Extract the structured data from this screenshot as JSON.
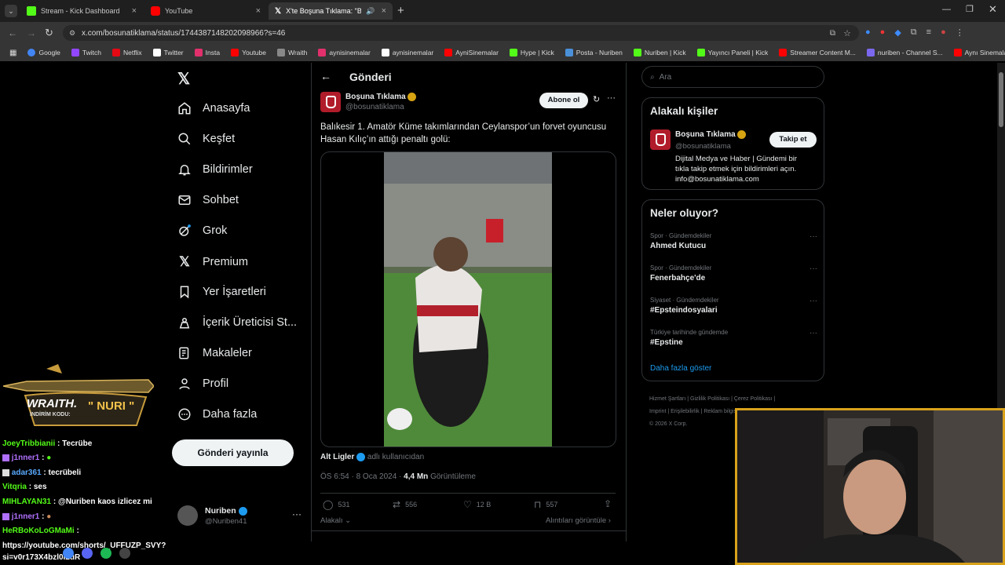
{
  "browser": {
    "tabs": [
      {
        "label": "Stream - Kick Dashboard",
        "icon": "kick-icon",
        "color": "#53fc18"
      },
      {
        "label": "YouTube",
        "icon": "youtube-icon",
        "color": "#ff0000"
      },
      {
        "label": "X'te Boşuna Tıklama: \"Balık...",
        "icon": "x-icon",
        "color": "#ffffff"
      }
    ],
    "url": "x.com/bosunatiklama/status/1744387148202098966?s=46",
    "bookmarks": [
      {
        "label": "Google",
        "color": "#4285f4"
      },
      {
        "label": "Twitch",
        "color": "#9146ff"
      },
      {
        "label": "Netflix",
        "color": "#e50914"
      },
      {
        "label": "Twitter",
        "color": "#ffffff"
      },
      {
        "label": "Insta",
        "color": "#e1306c"
      },
      {
        "label": "Youtube",
        "color": "#ff0000"
      },
      {
        "label": "Wraith",
        "color": "#888888"
      },
      {
        "label": "aynisinemalar",
        "color": "#e1306c"
      },
      {
        "label": "aynisinemalar",
        "color": "#ffffff"
      },
      {
        "label": "AyniSinemalar",
        "color": "#ff0000"
      },
      {
        "label": "Hype | Kick",
        "color": "#53fc18"
      },
      {
        "label": "Posta - Nuriben",
        "color": "#4a90d9"
      },
      {
        "label": "Nuriben | Kick",
        "color": "#53fc18"
      },
      {
        "label": "Yayıncı Paneli | Kick",
        "color": "#53fc18"
      },
      {
        "label": "Streamer Content M...",
        "color": "#ff0000"
      },
      {
        "label": "nuriben - Channel S...",
        "color": "#7b68ee"
      },
      {
        "label": "Aynı Sinemalar - Ça...",
        "color": "#ff0000"
      }
    ]
  },
  "nav": {
    "items": [
      {
        "label": "Anasayfa",
        "icon": "home-icon"
      },
      {
        "label": "Keşfet",
        "icon": "search-icon"
      },
      {
        "label": "Bildirimler",
        "icon": "bell-icon"
      },
      {
        "label": "Sohbet",
        "icon": "mail-icon"
      },
      {
        "label": "Grok",
        "icon": "grok-icon"
      },
      {
        "label": "Premium",
        "icon": "x-icon"
      },
      {
        "label": "Yer İşaretleri",
        "icon": "bookmark-icon"
      },
      {
        "label": "İçerik Üreticisi St...",
        "icon": "creator-icon"
      },
      {
        "label": "Makaleler",
        "icon": "article-icon"
      },
      {
        "label": "Profil",
        "icon": "person-icon"
      },
      {
        "label": "Daha fazla",
        "icon": "more-circle-icon"
      }
    ],
    "post_button": "Gönderi yayınla",
    "account": {
      "name": "Nuriben",
      "handle": "@Nuriben41"
    }
  },
  "post": {
    "header": "Gönderi",
    "author": {
      "name": "Boşuna Tıklama",
      "handle": "@bosunatiklama"
    },
    "subscribe": "Abone ol",
    "text_line1": "Balıkesir 1. Amatör Küme takımlarından Ceylanspor’un forvet oyuncusu",
    "text_line2": "Hasan Kılıç’ın attığı penaltı golü:",
    "attribution_name": "Alt Ligler",
    "attribution_suffix": "adlı kullanıcıdan",
    "time": "ÖS 6:54 · 8 Oca 2024 ·",
    "views_count": "4,4 Mn",
    "views_label": "Görüntüleme",
    "stats": {
      "replies": "531",
      "reposts": "556",
      "likes": "12 B",
      "bookmarks": "557"
    },
    "relevant": "Alakalı",
    "quotes": "Alıntıları görüntüle"
  },
  "sidebar": {
    "search_placeholder": "Ara",
    "relevant_title": "Alakalı kişiler",
    "person": {
      "name": "Boşuna Tıklama",
      "handle": "@bosunatiklama",
      "follow": "Takip et",
      "bio1": "Dijital Medya ve Haber | Gündemi bir",
      "bio2": "tıkla takip etmek için bildirimleri açın.",
      "bio3": "info@bosunatiklama.com"
    },
    "trends_title": "Neler oluyor?",
    "trends": [
      {
        "category": "Spor · Gündemdekiler",
        "name": "Ahmed Kutucu"
      },
      {
        "category": "Spor · Gündemdekiler",
        "name": "Fenerbahçe'de"
      },
      {
        "category": "Siyaset · Gündemdekiler",
        "name": "#Epsteindosyalari"
      },
      {
        "category": "Türkiye tarihinde gündemde",
        "name": "#Epstine"
      }
    ],
    "show_more": "Daha fazla göster",
    "footer1": "Hizmet Şartları | Gizlilik Politikası | Çerez Politikası |",
    "footer2": "Imprint | Erişilebilirlik | Reklam bilgisi | Daha fazla",
    "footer3": "© 2026 X Corp."
  },
  "overlay": {
    "banner_title": "WRAITH.",
    "banner_code_label": "İNDİRİM KODU:",
    "banner_code": "\" NURI \"",
    "chat": [
      {
        "user": "JoeyTribbianii",
        "msg": ": Tecrübe",
        "color": "#53fc18"
      },
      {
        "user": "j1nner1",
        "msg": ":",
        "color": "#b070ff"
      },
      {
        "user": "adar361",
        "msg": ": tecrübeli",
        "color": "#5aa9ff"
      },
      {
        "user": "Vitqria",
        "msg": ": ses",
        "color": "#53fc18"
      },
      {
        "user": "MIHLAYAN31",
        "msg": ": @Nuriben kaos izlicez mi",
        "color": "#53fc18"
      },
      {
        "user": "j1nner1",
        "msg": ":",
        "color": "#b070ff"
      },
      {
        "user": "HeRBoKoLoGMaMi",
        "msg": ":",
        "color": "#53fc18"
      }
    ],
    "link1": "https://youtube.com/shorts/_UFFUZP_SVY?",
    "link2": "si=v0r173X4bzl0i2uR"
  }
}
